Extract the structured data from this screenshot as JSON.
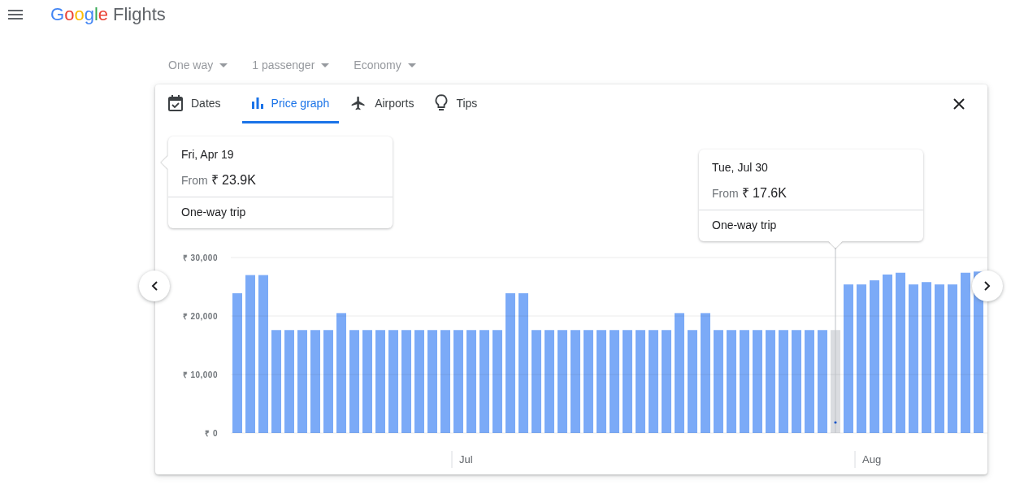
{
  "header": {
    "logo_letters": [
      {
        "char": "G",
        "color": "#4285f4"
      },
      {
        "char": "o",
        "color": "#ea4335"
      },
      {
        "char": "o",
        "color": "#fbbc05"
      },
      {
        "char": "g",
        "color": "#4285f4"
      },
      {
        "char": "l",
        "color": "#34a853"
      },
      {
        "char": "e",
        "color": "#ea4335"
      }
    ],
    "product": "Flights"
  },
  "filters": [
    {
      "label": "One way",
      "disabled": true
    },
    {
      "label": "1 passenger",
      "disabled": true
    },
    {
      "label": "Economy",
      "disabled": true
    }
  ],
  "tabs": [
    {
      "label": "Dates",
      "selected": false
    },
    {
      "label": "Price graph",
      "selected": true
    },
    {
      "label": "Airports",
      "selected": false
    },
    {
      "label": "Tips",
      "selected": false
    }
  ],
  "tooltips": [
    {
      "date": "Fri, Apr 19",
      "from": "From",
      "price": "₹ 23.9K",
      "trip": "One-way trip"
    },
    {
      "date": "Tue, Jul 30",
      "from": "From",
      "price": "₹ 17.6K",
      "trip": "One-way trip"
    }
  ],
  "chart": {
    "months": [
      {
        "label": "Jul"
      },
      {
        "label": "Aug"
      }
    ],
    "bars": [
      {
        "selected": false
      },
      {
        "selected": false
      },
      {
        "selected": false
      },
      {
        "selected": false
      },
      {
        "selected": false
      },
      {
        "selected": false
      },
      {
        "selected": false
      },
      {
        "selected": false
      },
      {
        "selected": false
      },
      {
        "selected": false
      },
      {
        "selected": false
      },
      {
        "selected": false
      },
      {
        "selected": false
      },
      {
        "selected": false
      },
      {
        "selected": false
      },
      {
        "selected": false
      },
      {
        "selected": false
      },
      {
        "selected": false
      },
      {
        "selected": false
      },
      {
        "selected": false
      },
      {
        "selected": false
      },
      {
        "selected": false
      },
      {
        "selected": false
      },
      {
        "selected": false
      },
      {
        "selected": false
      },
      {
        "selected": false
      },
      {
        "selected": false
      },
      {
        "selected": false
      },
      {
        "selected": false
      },
      {
        "selected": false
      },
      {
        "selected": false
      },
      {
        "selected": false
      },
      {
        "selected": false
      },
      {
        "selected": false
      },
      {
        "selected": false
      },
      {
        "selected": false
      },
      {
        "selected": false
      },
      {
        "selected": false
      },
      {
        "selected": false
      },
      {
        "selected": false
      },
      {
        "selected": false
      },
      {
        "selected": false
      },
      {
        "selected": false
      },
      {
        "selected": false
      },
      {
        "selected": false
      },
      {
        "selected": false
      },
      {
        "selected": true
      },
      {
        "selected": false
      },
      {
        "selected": false
      },
      {
        "selected": false
      },
      {
        "selected": false
      },
      {
        "selected": false
      },
      {
        "selected": false
      },
      {
        "selected": false
      },
      {
        "selected": false
      },
      {
        "selected": false
      },
      {
        "selected": false
      },
      {
        "selected": false
      }
    ],
    "chart_data": {
      "type": "bar",
      "ylim": [
        0,
        30000
      ],
      "yticks": [
        {
          "value": 0,
          "label": "₹ 0"
        },
        {
          "value": 10000,
          "label": "₹ 10,000"
        },
        {
          "value": 20000,
          "label": "₹ 20,000"
        },
        {
          "value": 30000,
          "label": "₹ 30,000"
        }
      ],
      "values": [
        23900,
        27000,
        27000,
        17600,
        17600,
        17600,
        17600,
        17600,
        20500,
        17600,
        17600,
        17600,
        17600,
        17600,
        17600,
        17600,
        17600,
        17600,
        17600,
        17600,
        17600,
        23900,
        23900,
        17600,
        17600,
        17600,
        17600,
        17600,
        17600,
        17600,
        17600,
        17600,
        17600,
        17600,
        20500,
        17600,
        20500,
        17600,
        17600,
        17600,
        17600,
        17600,
        17600,
        17600,
        17600,
        17600,
        17600,
        25400,
        25400,
        26100,
        27100,
        27400,
        25400,
        25800,
        25400,
        25400,
        27400,
        27600
      ]
    }
  }
}
